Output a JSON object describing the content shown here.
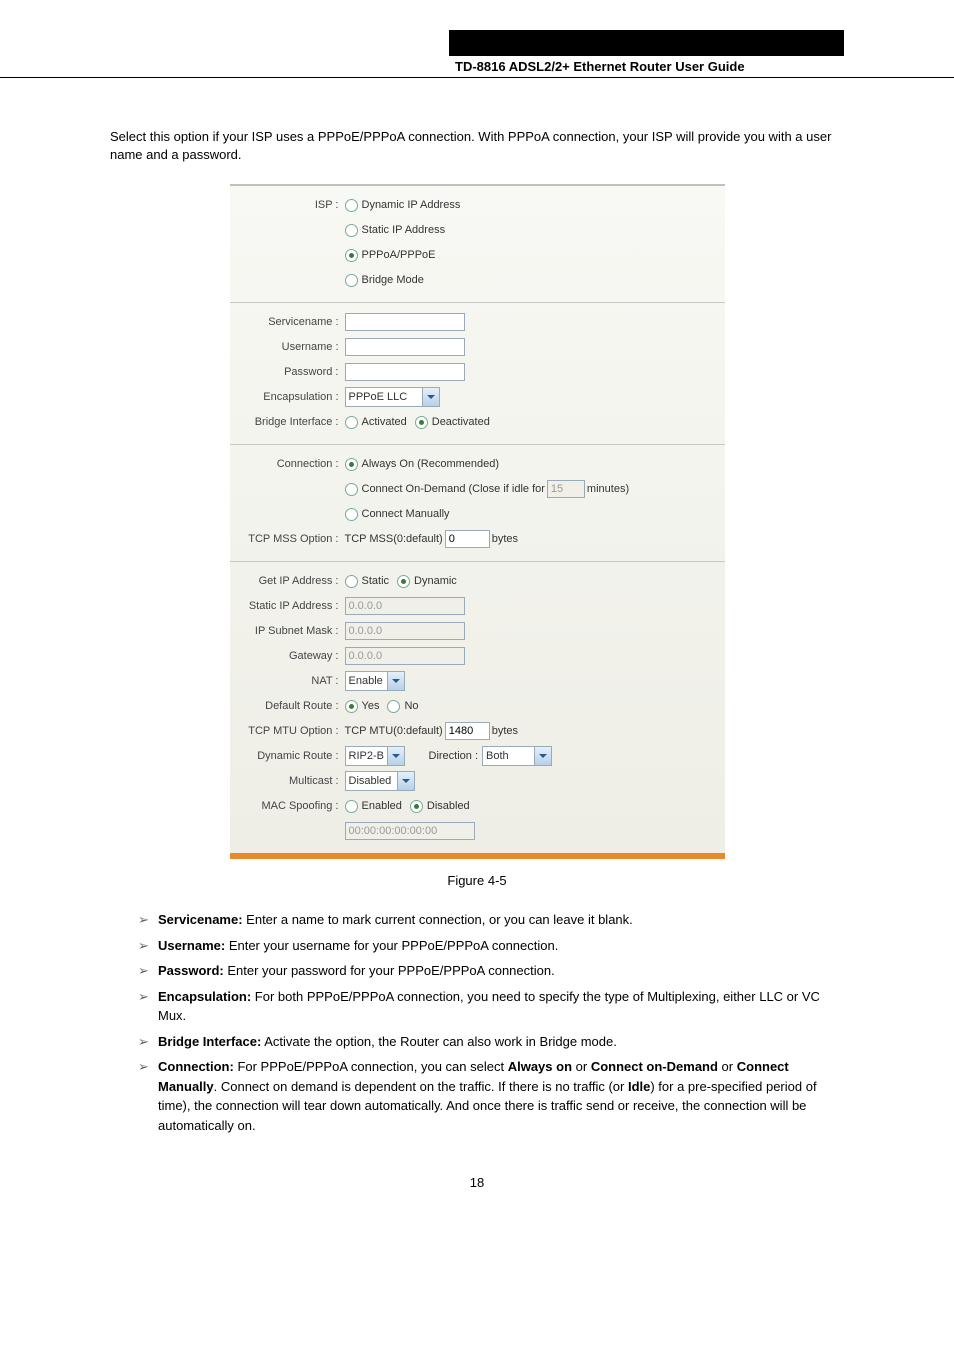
{
  "header": {
    "right_text": "",
    "model": "TD-8816 ADSL2/2+ Ethernet Router User Guide"
  },
  "intro": "Select this option if your ISP uses a PPPoE/PPPoA connection. With PPPoA connection, your ISP will provide you with a user name and a password.",
  "panel": {
    "isp_label": "ISP :",
    "isp_opts": {
      "dyn": "Dynamic IP Address",
      "stat": "Static IP Address",
      "pppoe": "PPPoA/PPPoE",
      "bridge": "Bridge Mode"
    },
    "servicename_label": "Servicename :",
    "username_label": "Username :",
    "password_label": "Password :",
    "encapsulation_label": "Encapsulation :",
    "encapsulation_value": "PPPoE LLC",
    "bridgeif_label": "Bridge Interface :",
    "bridgeif_opts": {
      "act": "Activated",
      "deact": "Deactivated"
    },
    "connection_label": "Connection :",
    "conn_opts": {
      "always": "Always On (Recommended)",
      "ondemand_pre": "Connect On-Demand (Close if idle for",
      "ondemand_val": "15",
      "ondemand_post": "minutes)",
      "manual": "Connect Manually"
    },
    "mss_label": "TCP MSS Option :",
    "mss_pre": "TCP MSS(0:default)",
    "mss_val": "0",
    "mss_post": "bytes",
    "getip_label": "Get IP Address :",
    "getip_opts": {
      "static": "Static",
      "dyn": "Dynamic"
    },
    "staticip_label": "Static IP Address :",
    "staticip_val": "0.0.0.0",
    "subnet_label": "IP Subnet Mask :",
    "subnet_val": "0.0.0.0",
    "gateway_label": "Gateway :",
    "gateway_val": "0.0.0.0",
    "nat_label": "NAT :",
    "nat_val": "Enable",
    "defroute_label": "Default Route :",
    "defroute_opts": {
      "yes": "Yes",
      "no": "No"
    },
    "mtu_label": "TCP MTU Option :",
    "mtu_pre": "TCP MTU(0:default)",
    "mtu_val": "1480",
    "mtu_post": "bytes",
    "dynroute_label": "Dynamic Route :",
    "dynroute_val": "RIP2-B",
    "dir_label": "Direction :",
    "dir_val": "Both",
    "multicast_label": "Multicast :",
    "multicast_val": "Disabled",
    "macspoof_label": "MAC Spoofing :",
    "macspoof_opts": {
      "en": "Enabled",
      "dis": "Disabled"
    },
    "macspoof_val": "00:00:00:00:00:00"
  },
  "caption": "Figure 4-5",
  "bullets": [
    {
      "bold": "Servicename:",
      "text": " Enter a name to mark current connection, or you can leave it blank."
    },
    {
      "bold": "Username:",
      "text": " Enter your username for your PPPoE/PPPoA connection."
    },
    {
      "bold": "Password:",
      "text": " Enter your password for your PPPoE/PPPoA connection."
    },
    {
      "bold": "Encapsulation:",
      "text": " For both PPPoE/PPPoA connection, you need to specify the type of Multiplexing, either LLC or VC Mux."
    },
    {
      "bold": "Bridge Interface:",
      "text": " Activate the option, the Router can also work in Bridge mode."
    },
    {
      "bold": "Connection:",
      "text": " For PPPoE/PPPoA connection, you can select ",
      "bold2": "Always on",
      "text2": " or ",
      "bold3": "Connect on-Demand",
      "text3": " or ",
      "bold4": "Connect Manually",
      "text4": ". Connect on demand is dependent on the traffic. If there is no traffic (or ",
      "bold5": "Idle",
      "text5": ") for a pre-specified period of time), the connection will tear down automatically. And once there is traffic send or receive, the connection will be automatically on."
    }
  ],
  "page_num": "18"
}
